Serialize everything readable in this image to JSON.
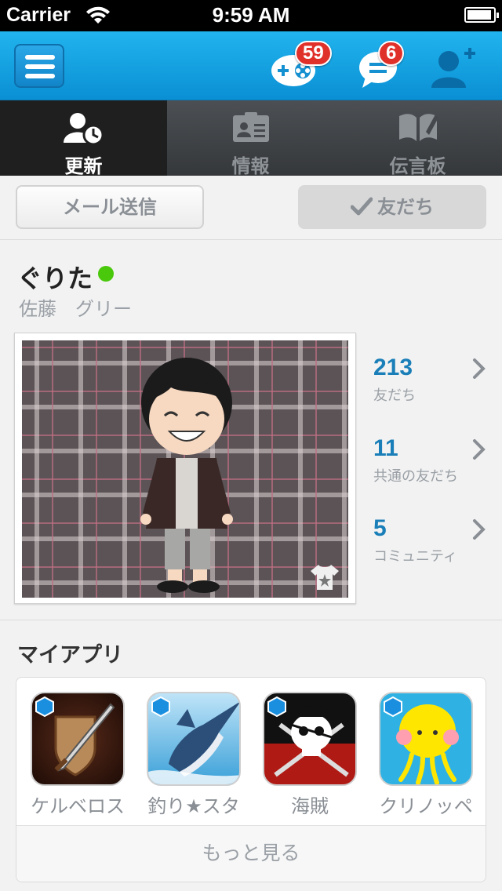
{
  "status_bar": {
    "carrier": "Carrier",
    "time": "9:59 AM"
  },
  "nav": {
    "games_badge": "59",
    "messages_badge": "6"
  },
  "tabs": [
    {
      "label": "更新",
      "active": true,
      "icon": "person-clock-icon"
    },
    {
      "label": "情報",
      "active": false,
      "icon": "id-card-icon"
    },
    {
      "label": "伝言板",
      "active": false,
      "icon": "book-pen-icon"
    }
  ],
  "actions": {
    "mail_label": "メール送信",
    "friend_label": "友だち"
  },
  "profile": {
    "nickname": "ぐりた",
    "online": true,
    "real_name": "佐藤　グリー",
    "stats": [
      {
        "value": "213",
        "label": "友だち"
      },
      {
        "value": "11",
        "label": "共通の友だち"
      },
      {
        "value": "5",
        "label": "コミュニティ"
      }
    ]
  },
  "my_apps": {
    "title": "マイアプリ",
    "apps": [
      {
        "name": "ケルベロス"
      },
      {
        "name": "釣り★スタ"
      },
      {
        "name": "海賊"
      },
      {
        "name": "クリノッペ"
      }
    ],
    "more_label": "もっと見る"
  },
  "colors": {
    "accent": "#1a7fb8",
    "nav_bar": "#15a3e3",
    "online": "#4ac80c",
    "badge": "#e0302a"
  }
}
